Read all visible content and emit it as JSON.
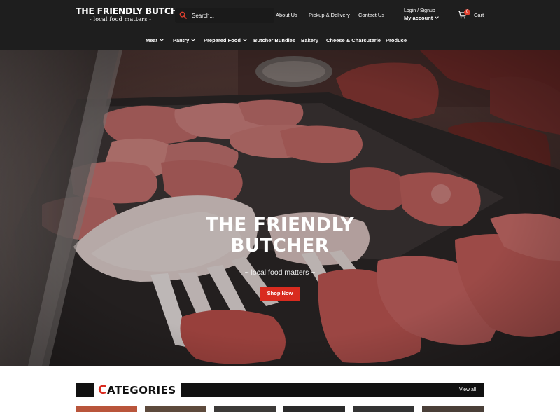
{
  "brand": {
    "name": "THE FRIENDLY BUTCHER",
    "tagline": "- local food matters -"
  },
  "search": {
    "placeholder": "Search..."
  },
  "top_links": [
    {
      "label": "About Us"
    },
    {
      "label": "Pickup & Delivery"
    },
    {
      "label": "Contact Us"
    }
  ],
  "account": {
    "top_label": "Login / Signup",
    "main_label": "My account"
  },
  "cart": {
    "count": "0",
    "label": "Cart"
  },
  "nav": [
    {
      "label": "Meat",
      "dropdown": true
    },
    {
      "label": "Pantry",
      "dropdown": true
    },
    {
      "label": "Prepared Food",
      "dropdown": true
    },
    {
      "label": "Butcher Bundles",
      "dropdown": false
    },
    {
      "label": "Bakery",
      "dropdown": false
    },
    {
      "label": "Cheese & Charcuterie",
      "dropdown": false
    },
    {
      "label": "Produce",
      "dropdown": false
    }
  ],
  "hero": {
    "title_line1": "THE FRIENDLY",
    "title_line2": "BUTCHER",
    "subtitle": "~ local food matters ~",
    "button_label": "Shop Now"
  },
  "categories": {
    "title_first": "C",
    "title_rest": "ATEGORIES",
    "view_all": "View all"
  },
  "colors": {
    "header_bg": "#1e1e1e",
    "accent": "#d92b1f",
    "badge": "#e0402f"
  },
  "icons": [
    "search-icon",
    "chevron-down-icon",
    "cart-icon"
  ]
}
